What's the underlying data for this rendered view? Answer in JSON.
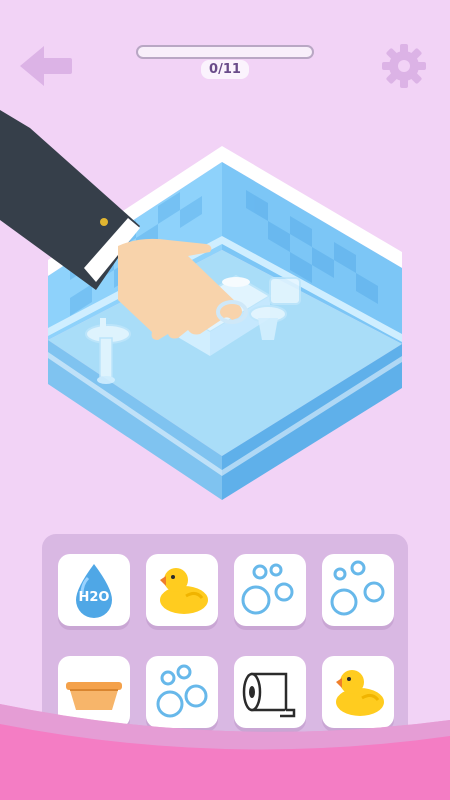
{
  "hud": {
    "progress_text": "0/11",
    "progress_fraction": 0,
    "back_icon": "back-arrow-icon",
    "settings_icon": "gear-icon"
  },
  "scene": {
    "room": "bathroom",
    "items": [
      "sink-icon",
      "bathtub-icon",
      "toilet-icon",
      "cleaning-hand-icon"
    ]
  },
  "tray": {
    "items": [
      {
        "icon": "water-drop-icon",
        "label": "H2O"
      },
      {
        "icon": "rubber-duck-icon"
      },
      {
        "icon": "bubbles-icon"
      },
      {
        "icon": "bubbles-icon"
      },
      {
        "icon": "basin-icon"
      },
      {
        "icon": "bubbles-icon"
      },
      {
        "icon": "toilet-paper-icon"
      },
      {
        "icon": "rubber-duck-icon"
      }
    ]
  },
  "colors": {
    "background": "#f2d3f6",
    "tray": "#d9b8e3",
    "water": "#4fa7e6",
    "duck": "#ffcc1f",
    "basin": "#f4a14a",
    "bubbles": "#67b8ea",
    "pink_band": "#f47dc4",
    "wall_tile": "#8ed2fb",
    "floor": "#a9ddf8"
  }
}
